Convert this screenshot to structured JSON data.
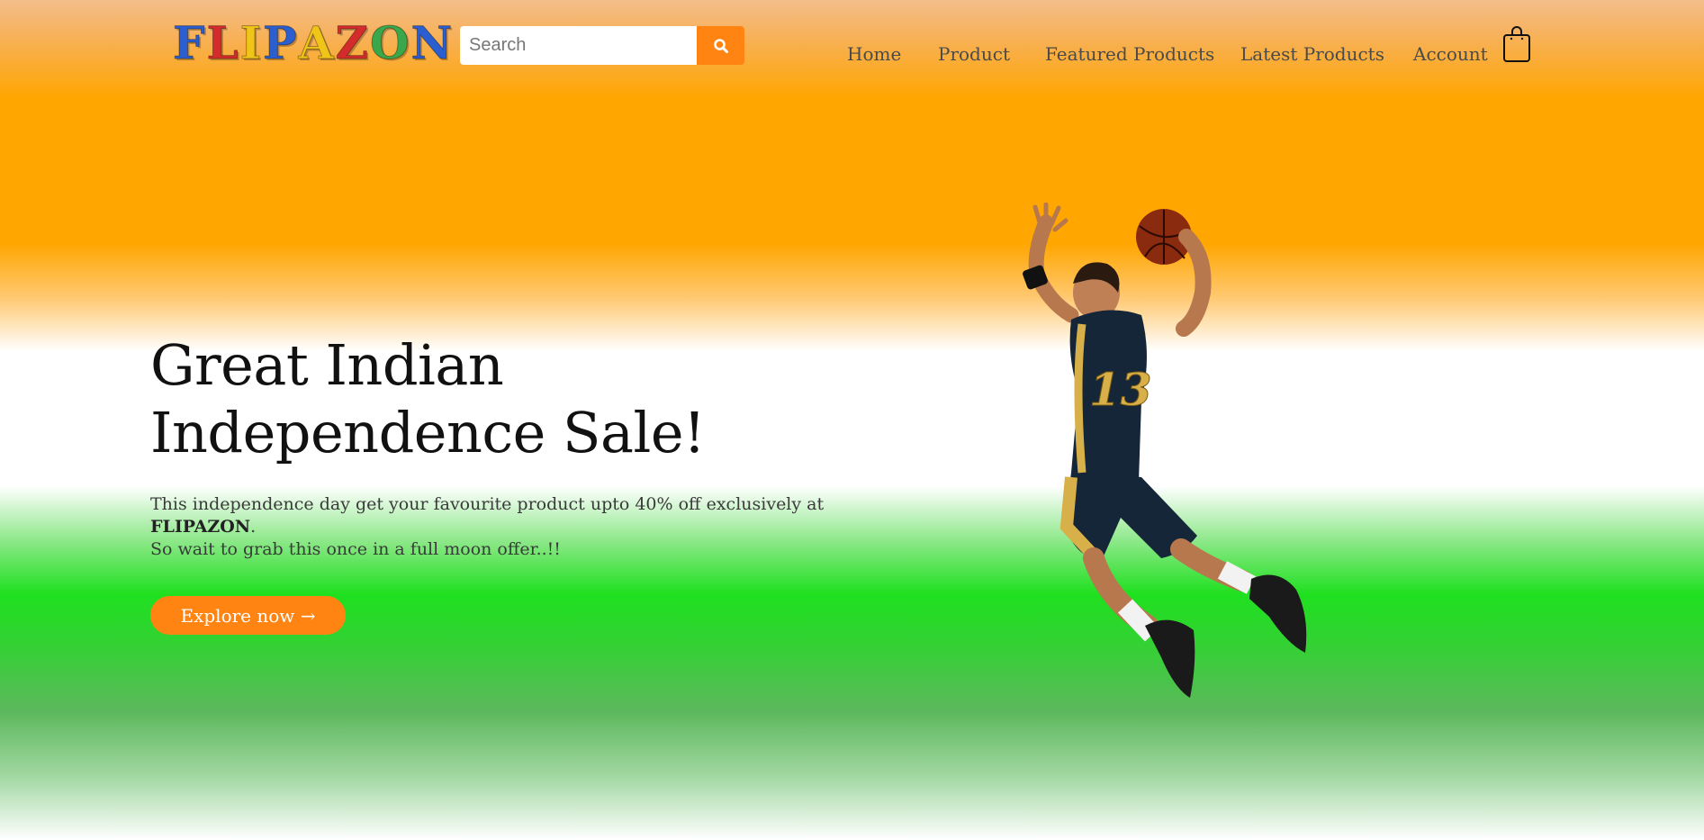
{
  "brand": {
    "letters": [
      {
        "char": "F",
        "color": "#2b5fd0"
      },
      {
        "char": "L",
        "color": "#d42c2c"
      },
      {
        "char": "I",
        "color": "#f0c419"
      },
      {
        "char": "P",
        "color": "#2b5fd0"
      },
      {
        "char": "A",
        "color": "#f0c419"
      },
      {
        "char": "Z",
        "color": "#d42c2c"
      },
      {
        "char": "O",
        "color": "#3aa84a"
      },
      {
        "char": "N",
        "color": "#2b5fd0"
      }
    ]
  },
  "search": {
    "placeholder": "Search",
    "value": "",
    "button_icon": "search-icon"
  },
  "nav": {
    "items": [
      {
        "label": "Home"
      },
      {
        "label": "Product"
      },
      {
        "label": "Featured Products"
      },
      {
        "label": "Latest Products"
      },
      {
        "label": "Account"
      }
    ],
    "cart_icon": "shopping-bag-icon"
  },
  "hero": {
    "title_line1": "Great Indian",
    "title_line2": "Independence Sale!",
    "text_line1": "This independence day get your favourite product upto 40% off exclusively at",
    "text_brand": "FLIPAZON",
    "text_brand_suffix": ".",
    "text_line2": "So wait to grab this once in a full moon offer..!!",
    "cta_label": "Explore now →",
    "image": "basketball-player-jumping",
    "jersey_number": "13"
  },
  "colors": {
    "accent": "#ff8412",
    "saffron": "#ffa600",
    "green": "#1fe01f",
    "white": "#ffffff"
  }
}
